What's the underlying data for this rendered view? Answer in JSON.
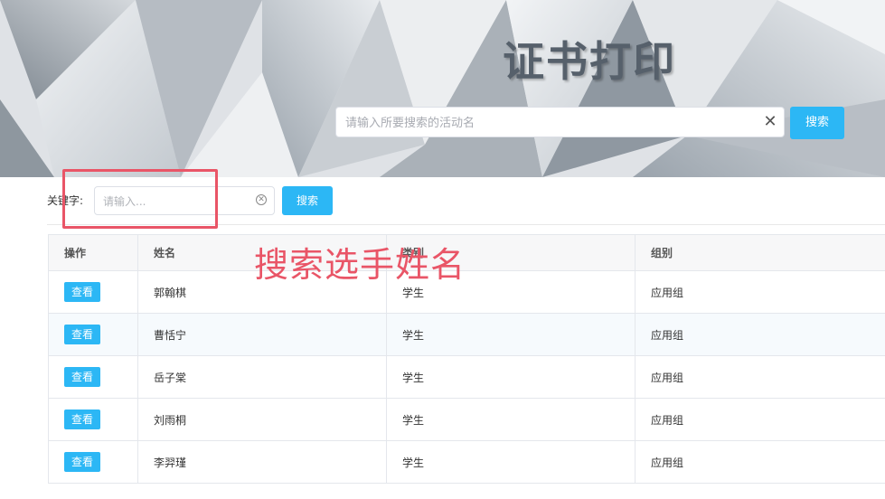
{
  "banner": {
    "title": "证书打印",
    "search": {
      "placeholder": "请输入所要搜索的活动名",
      "value": "",
      "clear_icon": "close-icon"
    },
    "search_button": "搜索"
  },
  "filter": {
    "label": "关键字:",
    "input": {
      "placeholder": "请输入...",
      "value": "",
      "clear_icon": "circle-close-icon"
    },
    "search_button": "搜索"
  },
  "annotation": {
    "text": "搜索选手姓名",
    "color": "#e95567"
  },
  "colors": {
    "accent": "#2cb7f5"
  },
  "table": {
    "headers": {
      "action": "操作",
      "name": "姓名",
      "category": "类别",
      "group": "组别"
    },
    "rows": [
      {
        "action": "查看",
        "name": "郭翰棋",
        "category": "学生",
        "group": "应用组"
      },
      {
        "action": "查看",
        "name": "曹恬宁",
        "category": "学生",
        "group": "应用组"
      },
      {
        "action": "查看",
        "name": "岳子棠",
        "category": "学生",
        "group": "应用组"
      },
      {
        "action": "查看",
        "name": "刘雨桐",
        "category": "学生",
        "group": "应用组"
      },
      {
        "action": "查看",
        "name": "李羿瑾",
        "category": "学生",
        "group": "应用组"
      }
    ]
  }
}
